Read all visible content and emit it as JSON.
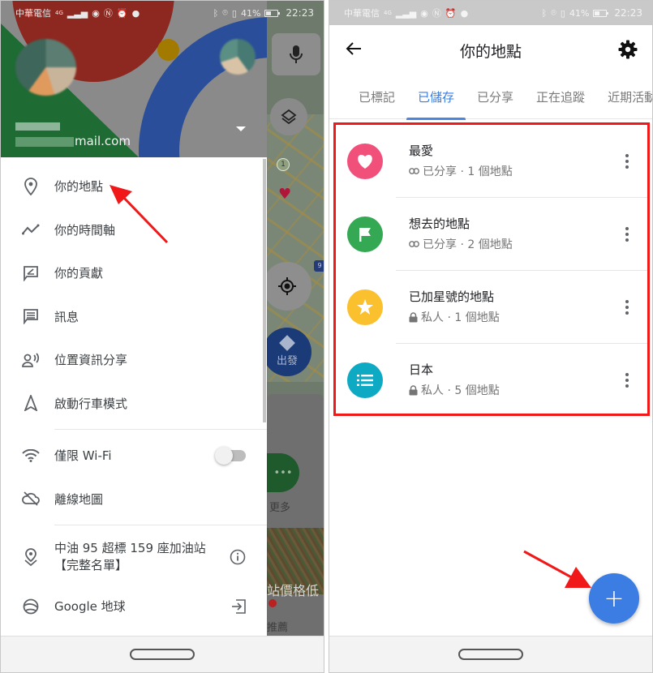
{
  "status_bar": {
    "carrier": "中華電信",
    "network": "4G",
    "battery": "41%",
    "time": "22:23"
  },
  "left_screen": {
    "account": {
      "email_suffix": "mail.com"
    },
    "menu": {
      "items": [
        {
          "label": "你的地點",
          "icon": "pin-icon"
        },
        {
          "label": "你的時間軸",
          "icon": "timeline-icon"
        },
        {
          "label": "你的貢獻",
          "icon": "contribute-icon"
        },
        {
          "label": "訊息",
          "icon": "message-icon"
        },
        {
          "label": "位置資訊分享",
          "icon": "location-share-icon"
        },
        {
          "label": "啟動行車模式",
          "icon": "navigation-icon"
        }
      ],
      "settings_items": [
        {
          "label": "僅限 Wi-Fi",
          "icon": "wifi-icon",
          "toggle_on": false
        },
        {
          "label": "離線地圖",
          "icon": "offline-cloud-icon"
        }
      ],
      "promo_items": [
        {
          "line1": "中油 95 超標 159 座加油站",
          "line2": "【完整名單】",
          "icon": "pin-promo-icon",
          "trailing": "info-icon"
        },
        {
          "label": "Google 地球",
          "icon": "earth-icon",
          "trailing": "open-external-icon"
        }
      ]
    },
    "map": {
      "route_badge_1": "1",
      "route_badge_9": "9",
      "go_label": "出發",
      "more_label": "更多",
      "photo_caption": "站價格低",
      "recommend_label": "推薦"
    }
  },
  "right_screen": {
    "title": "你的地點",
    "tabs": [
      {
        "label": "已標記",
        "active": false
      },
      {
        "label": "已儲存",
        "active": true
      },
      {
        "label": "已分享",
        "active": false
      },
      {
        "label": "正在追蹤",
        "active": false
      },
      {
        "label": "近期活動",
        "active": false
      }
    ],
    "lists": [
      {
        "name": "最愛",
        "privacy": "已分享",
        "count": "1 個地點",
        "meta": "已分享 · 1 個地點",
        "icon": "heart-icon",
        "color": "#f0507a"
      },
      {
        "name": "想去的地點",
        "privacy": "已分享",
        "count": "2 個地點",
        "meta": "已分享 · 2 個地點",
        "icon": "flag-icon",
        "color": "#34a853"
      },
      {
        "name": "已加星號的地點",
        "privacy": "私人",
        "count": "1 個地點",
        "meta": "私人 · 1 個地點",
        "icon": "star-icon",
        "color": "#fbc02d"
      },
      {
        "name": "日本",
        "privacy": "私人",
        "count": "5 個地點",
        "meta": "私人 · 5 個地點",
        "icon": "list-icon",
        "color": "#0eaac4"
      }
    ],
    "fab_label": "+"
  },
  "colors": {
    "accent": "#3a7de0",
    "annotation": "#f01818",
    "fab": "#3b7de3"
  }
}
